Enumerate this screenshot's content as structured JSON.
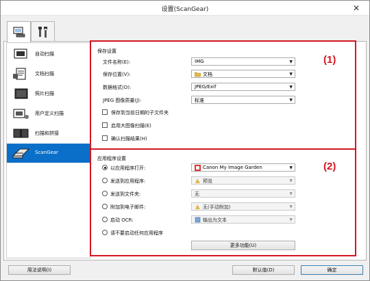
{
  "window": {
    "title": "设置(ScanGear)",
    "close_glyph": "✕"
  },
  "tabs": [
    {
      "icon": "scan-settings-icon",
      "active": true
    },
    {
      "icon": "tools-icon",
      "active": false
    }
  ],
  "sidebar": {
    "items": [
      {
        "label": "自动扫描",
        "icon": "auto-scan-icon"
      },
      {
        "label": "文档扫描",
        "icon": "document-scan-icon"
      },
      {
        "label": "照片扫描",
        "icon": "photo-scan-icon"
      },
      {
        "label": "用户定义扫描",
        "icon": "custom-scan-icon"
      },
      {
        "label": "扫描和拼接",
        "icon": "scan-stitch-icon"
      },
      {
        "label": "ScanGear",
        "icon": "scangear-icon",
        "selected": true
      }
    ]
  },
  "save_settings": {
    "title": "保存设置",
    "marker": "(1)",
    "file_name": {
      "label": "文件名称(E):",
      "value": "IMG"
    },
    "save_in": {
      "label": "保存位置(V):",
      "value": "文档"
    },
    "data_format": {
      "label": "数据格式(O):",
      "value": "JPEG/Exif"
    },
    "jpeg_quality": {
      "label": "JPEG 图像质量(J):",
      "value": "标准"
    },
    "checkboxes": [
      {
        "label": "保存到当前日期的子文件夹",
        "checked": false
      },
      {
        "label": "启用大图像扫描(E)",
        "checked": false
      },
      {
        "label": "确认扫描结果(H)",
        "checked": false
      }
    ]
  },
  "app_settings": {
    "title": "应用程序设置",
    "marker": "(2)",
    "options": [
      {
        "label": "以应用程序打开:",
        "selected": true,
        "value": "Canon My Image Garden",
        "enabled": true
      },
      {
        "label": "发送到应用程序:",
        "selected": false,
        "value": "预览",
        "enabled": false
      },
      {
        "label": "发送到文件夹:",
        "selected": false,
        "value": "无",
        "enabled": false
      },
      {
        "label": "附加到电子邮件:",
        "selected": false,
        "value": "无(手动附加)",
        "enabled": false
      },
      {
        "label": "启动 OCR:",
        "selected": false,
        "value": "输出为文本",
        "enabled": false
      },
      {
        "label": "请不要启动任何应用程序",
        "selected": false
      }
    ],
    "more_functions": "更多功能(U)"
  },
  "footer": {
    "help": "用法说明(I)",
    "defaults": "默认值(D)",
    "ok": "确定"
  }
}
